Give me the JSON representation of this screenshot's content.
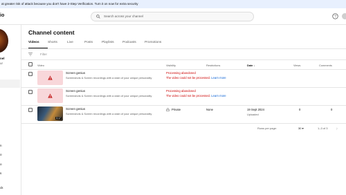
{
  "banner": {
    "text": "at greater risk of attack because you don't have 2-Step Verification. Turn it on now for extra security"
  },
  "topbar": {
    "logo": "io",
    "search_placeholder": "Search across your channel"
  },
  "sidebar": {
    "name_partial": "nel",
    "label_partial": "ur",
    "items": [
      "n",
      "o",
      "o",
      "s",
      "ck"
    ]
  },
  "page": {
    "title": "Channel content"
  },
  "tabs": [
    "Videos",
    "Shorts",
    "Live",
    "Posts",
    "Playlists",
    "Podcasts",
    "Promotions"
  ],
  "filter": {
    "label": "Filter"
  },
  "table": {
    "headers": {
      "video": "Video",
      "visibility": "Visibility",
      "restrictions": "Restrictions",
      "date": "Date",
      "views": "Views",
      "comments": "Comments"
    },
    "rows": [
      {
        "title": "Screen genius",
        "description": "Screenshots & Screen recordings with a dash of your unique personality",
        "status": "Processing abandoned",
        "error": "The video could not be processed.",
        "learn": "Learn more"
      },
      {
        "title": "Screen genius",
        "description": "Screenshots & Screen recordings with a dash of your unique personality",
        "status": "Processing abandoned",
        "error": "The video could not be processed.",
        "learn": "Learn more"
      },
      {
        "title": "Screen genius",
        "description": "Screenshots & Screen recordings with a dash of your unique personality",
        "duration": "0:17",
        "visibility": "Private",
        "restrictions": "None",
        "date": "19 Sept 2024",
        "date_status": "Uploaded",
        "views": "0",
        "comments": "0"
      }
    ]
  },
  "pagination": {
    "rows_label": "Rows per page:",
    "rows_value": "30",
    "range": "1–3 of 3"
  },
  "colors": {
    "accent_link": "#065fd4",
    "error": "#cc0000",
    "banner_bg": "#e8f0fe"
  }
}
